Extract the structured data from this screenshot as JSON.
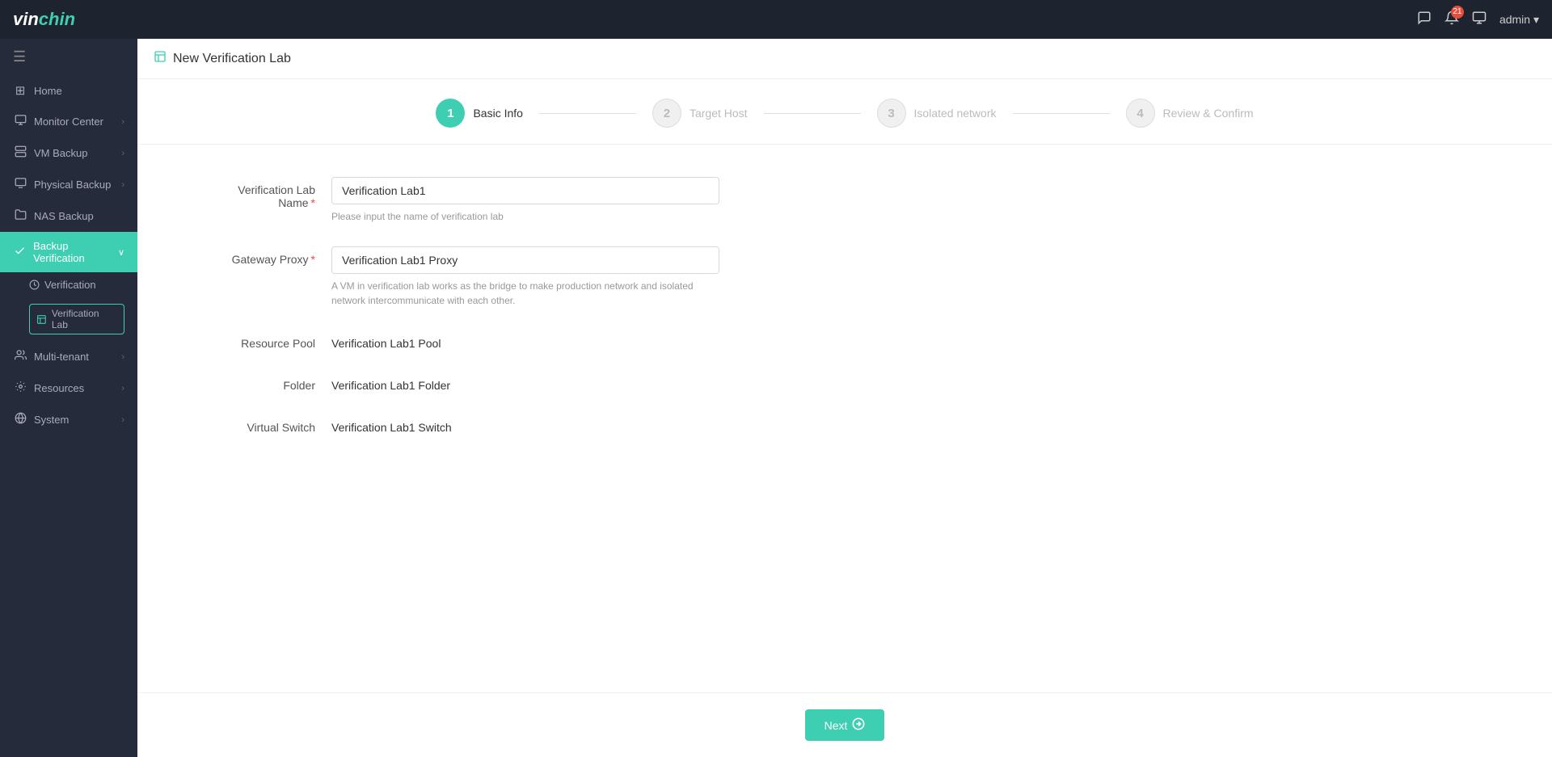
{
  "app": {
    "logo_v": "vin",
    "logo_chin": "chin",
    "notification_count": "21"
  },
  "topnav": {
    "admin_label": "admin ▾"
  },
  "sidebar": {
    "items": [
      {
        "id": "home",
        "icon": "⊞",
        "label": "Home",
        "active": false,
        "has_sub": false
      },
      {
        "id": "monitor-center",
        "icon": "📊",
        "label": "Monitor Center",
        "active": false,
        "has_sub": true
      },
      {
        "id": "vm-backup",
        "icon": "💾",
        "label": "VM Backup",
        "active": false,
        "has_sub": true
      },
      {
        "id": "physical-backup",
        "icon": "🖥",
        "label": "Physical Backup",
        "active": false,
        "has_sub": true
      },
      {
        "id": "nas-backup",
        "icon": "📁",
        "label": "NAS Backup",
        "active": false,
        "has_sub": false
      },
      {
        "id": "backup-verification",
        "icon": "✓",
        "label": "Backup Verification",
        "active": true,
        "has_sub": true
      },
      {
        "id": "multi-tenant",
        "icon": "👥",
        "label": "Multi-tenant",
        "active": false,
        "has_sub": true
      },
      {
        "id": "resources",
        "icon": "⚙",
        "label": "Resources",
        "active": false,
        "has_sub": true
      },
      {
        "id": "system",
        "icon": "🔧",
        "label": "System",
        "active": false,
        "has_sub": true
      }
    ],
    "sub_items": {
      "backup-verification": [
        {
          "id": "verification",
          "label": "Verification",
          "active": false
        },
        {
          "id": "verification-lab",
          "label": "Verification Lab",
          "active": true
        }
      ]
    }
  },
  "page": {
    "header_icon": "🗒",
    "title": "New Verification Lab",
    "steps": [
      {
        "number": "1",
        "label": "Basic Info",
        "active": true
      },
      {
        "number": "2",
        "label": "Target Host",
        "active": false
      },
      {
        "number": "3",
        "label": "Isolated network",
        "active": false
      },
      {
        "number": "4",
        "label": "Review & Confirm",
        "active": false
      }
    ],
    "form": {
      "lab_name_label": "Verification Lab Name",
      "lab_name_required": "*",
      "lab_name_value": "Verification Lab1",
      "lab_name_placeholder": "Verification Lab1",
      "lab_name_hint": "Please input the name of verification lab",
      "gateway_proxy_label": "Gateway Proxy",
      "gateway_proxy_required": "*",
      "gateway_proxy_value": "Verification Lab1 Proxy",
      "gateway_proxy_hint": "A VM in verification lab works as the bridge to make production network and isolated network intercommunicate with each other.",
      "resource_pool_label": "Resource Pool",
      "resource_pool_value": "Verification Lab1 Pool",
      "folder_label": "Folder",
      "folder_value": "Verification Lab1 Folder",
      "virtual_switch_label": "Virtual Switch",
      "virtual_switch_value": "Verification Lab1 Switch"
    },
    "footer": {
      "next_label": "Next"
    }
  }
}
